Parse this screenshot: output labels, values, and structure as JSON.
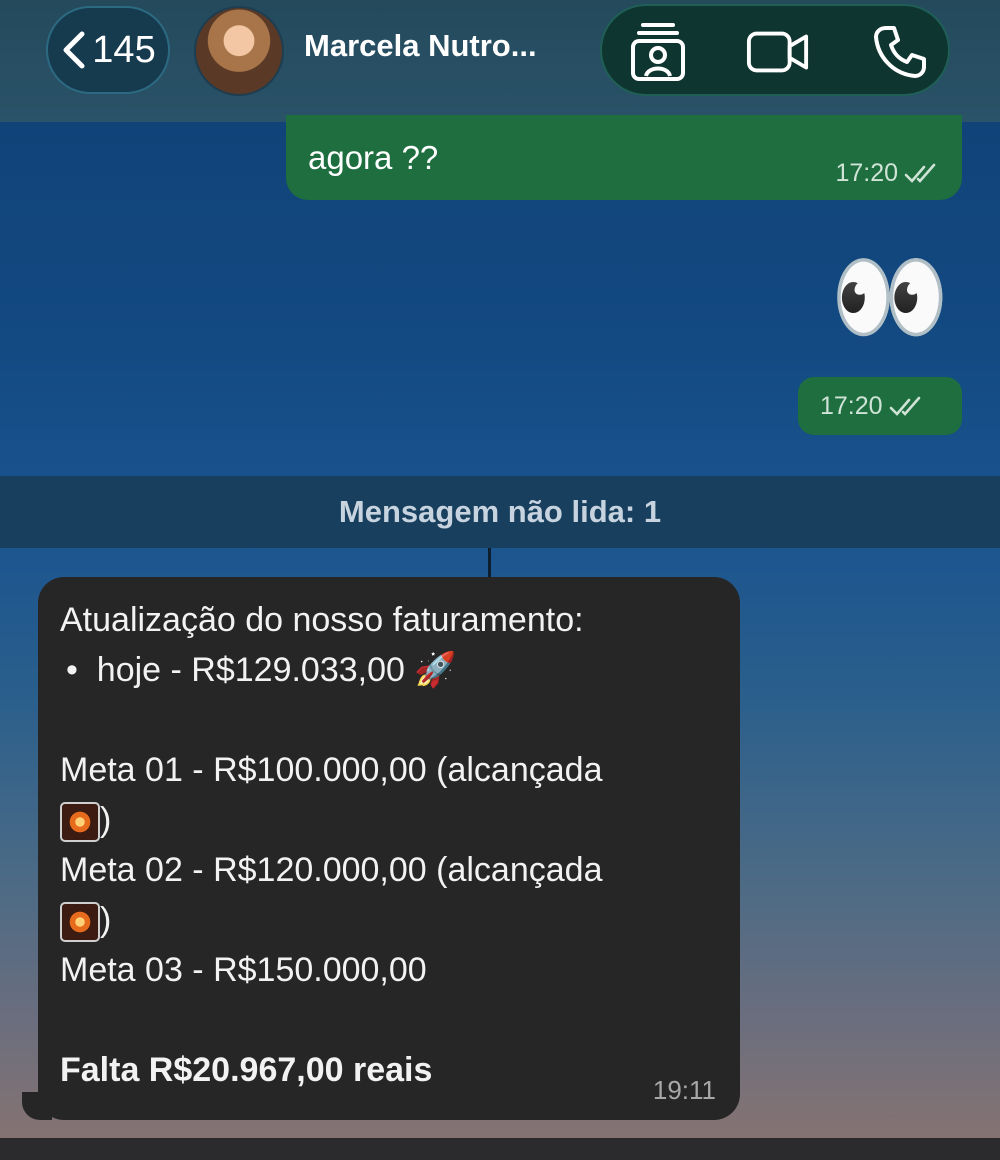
{
  "header": {
    "back_count": "145",
    "contact_name": "Marcela Nutro...",
    "icons": [
      "chevron-left-icon",
      "contact-card-icon",
      "video-camera-icon",
      "phone-icon"
    ]
  },
  "messages_outgoing": [
    {
      "text": "agora ??",
      "time": "17:20",
      "status": "read-double-check"
    },
    {
      "emoji": "👀",
      "time": "17:20",
      "status": "read-double-check"
    }
  ],
  "unread_banner": "Mensagem não lida: 1",
  "incoming": {
    "title": "Atualização do nosso faturamento:",
    "bullet": "hoje - R$129.033,00",
    "bullet_emoji": "🚀",
    "meta1": "Meta 01 - R$100.000,00 (alcançada",
    "meta2": "Meta 02 - R$120.000,00 (alcançada",
    "close_paren": ")",
    "meta3": "Meta 03 - R$150.000,00",
    "falta": "Falta R$20.967,00 reais",
    "time": "19:11"
  },
  "colors": {
    "outgoing_bubble": "#1e6e3f",
    "incoming_bubble": "#262626",
    "header_bg": "#244a5c"
  }
}
